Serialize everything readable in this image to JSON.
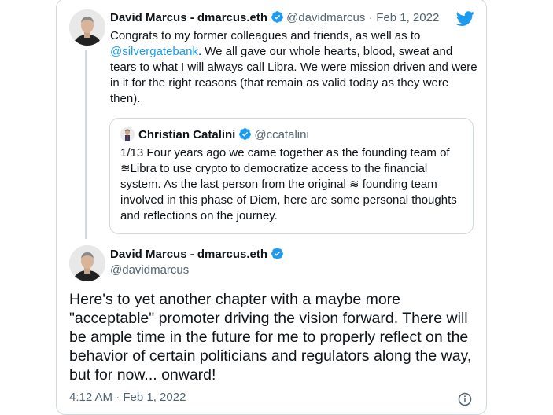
{
  "reply_tweet": {
    "author_name": "David Marcus - dmarcus.eth",
    "author_handle": "@davidmarcus",
    "separator": "·",
    "date": "Feb 1, 2022",
    "text_before_mention": "Congrats to my former colleagues and friends, as well as to",
    "mention": "@silvergatebank",
    "text_after_mention": ". We all gave our whole hearts, blood, sweat and tears to what I will always call Libra. We were mission driven and were in it for the right reasons (that remain as valid today as they were then)."
  },
  "quoted_tweet": {
    "author_name": "Christian Catalini",
    "author_handle": "@ccatalini",
    "text": "1/13 Four years ago we came together as the founding team of ≋Libra to use crypto to democratize access to the financial system. As the last person from the original ≋ founding team involved in this phase of Diem, here are some personal thoughts and reflections on the journey."
  },
  "main_tweet": {
    "author_name": "David Marcus - dmarcus.eth",
    "author_handle": "@davidmarcus",
    "text": "Here's to yet another chapter with a maybe more \"acceptable\" promoter driving the vision forward. There will be ample time in the future for me to properly reflect on the behavior of certain politicians and regulators along the way, but for now... onward!",
    "timestamp": "4:12 AM · Feb 1, 2022"
  },
  "icons": {
    "brand": "twitter-bird-icon",
    "verified": "verified-badge-icon",
    "info": "info-icon"
  },
  "colors": {
    "accent": "#1d9bf0",
    "text": "#0f1419",
    "secondary": "#536471",
    "border": "#cfd9de"
  }
}
